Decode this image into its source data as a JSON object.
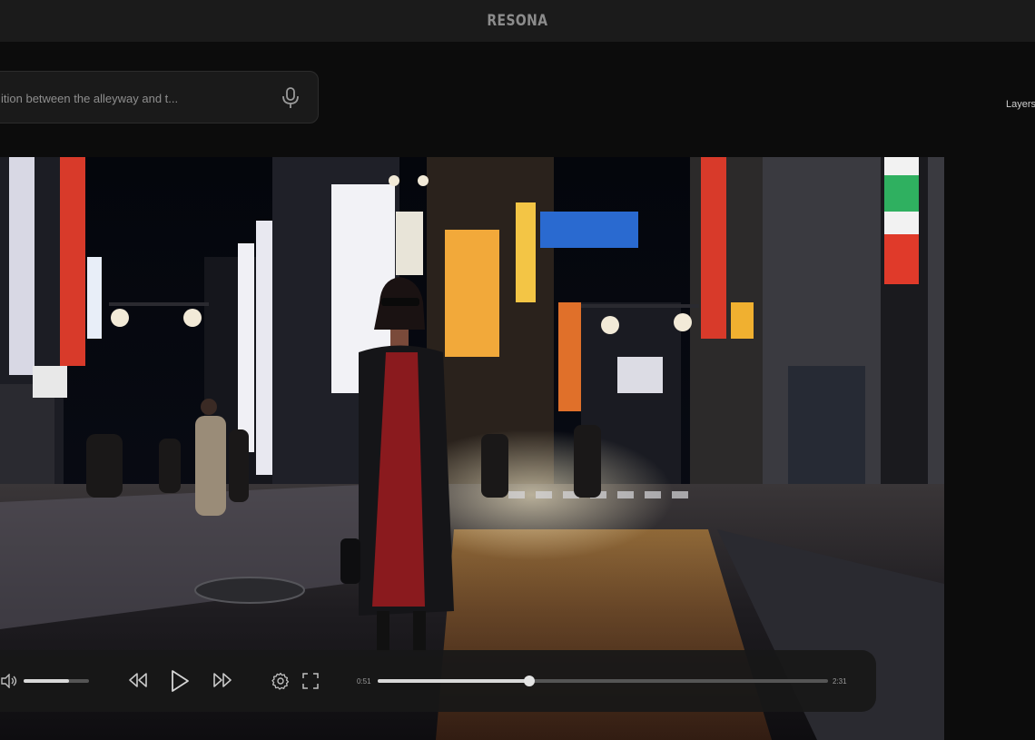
{
  "app": {
    "title": "RESONA"
  },
  "prompt": {
    "text": "ition between the alleyway and t...",
    "mic_icon": "microphone-icon"
  },
  "right_panel": {
    "layers_label": "Layers"
  },
  "video": {
    "description_icons": [
      "volume-icon",
      "rewind-icon",
      "play-icon",
      "fast-forward-icon",
      "settings-icon",
      "fullscreen-icon"
    ]
  },
  "player": {
    "current_time": "0:51",
    "duration": "2:31",
    "progress": 0.336,
    "volume": 0.7
  },
  "colors": {
    "accent_track": "#d9d9d9",
    "panel_bg": "#181818",
    "topbar_bg": "#1b1b1b"
  }
}
